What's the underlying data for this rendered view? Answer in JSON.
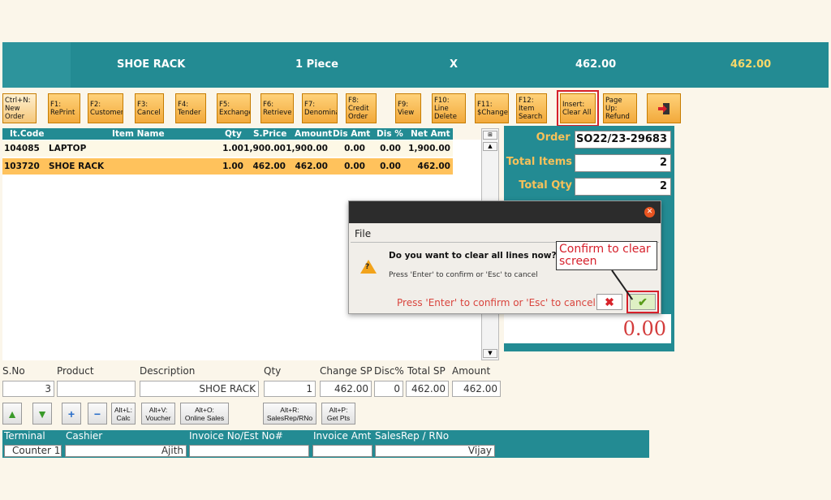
{
  "topbar": {
    "item": "SHOE RACK",
    "qty": "1 Piece",
    "x": "X",
    "price": "462.00",
    "total": "462.00"
  },
  "toolbar": [
    {
      "label": "Ctrl+N:\nNew\nOrder"
    },
    {
      "label": "F1:\nRePrint"
    },
    {
      "label": "F2:\nCustomer"
    },
    {
      "label": "F3:\nCancel"
    },
    {
      "label": "F4:\nTender"
    },
    {
      "label": "F5:\nExchange"
    },
    {
      "label": "F6:\nRetrieve"
    },
    {
      "label": "F7:\nDenomina"
    },
    {
      "label": "F8:\nCredit\nOrder"
    },
    {
      "label": "F9:\nView"
    },
    {
      "label": "F10:\nLine\nDelete"
    },
    {
      "label": "F11:\n$Change"
    },
    {
      "label": "F12:\nItem\nSearch"
    },
    {
      "label": "Insert:\nClear All"
    },
    {
      "label": "Page Up:\nRefund"
    }
  ],
  "grid": {
    "headers": [
      "It.Code",
      "Item Name",
      "Qty",
      "S.Price",
      "Amount",
      "Dis Amt",
      "Dis %",
      "Net Amt"
    ],
    "rows": [
      [
        "104085",
        "LAPTOP",
        "1.00",
        "1,900.00",
        "1,900.00",
        "0.00",
        "0.00",
        "1,900.00"
      ],
      [
        "103720",
        "SHOE RACK",
        "1.00",
        "462.00",
        "462.00",
        "0.00",
        "0.00",
        "462.00"
      ]
    ]
  },
  "right_panel": {
    "order_no_label": "Order No",
    "order_no": "SO22/23-29683",
    "total_items_label": "Total Items",
    "total_items": "2",
    "total_qty_label": "Total Qty",
    "total_qty": "2",
    "amount": "0.00"
  },
  "dialog": {
    "menu": "File",
    "question": "Do you want to clear all lines now?",
    "hint": "Press 'Enter' to confirm or 'Esc' to cancel",
    "hint_red": "Press 'Enter' to confirm or 'Esc' to cancel",
    "close_glyph": "✕",
    "cancel_glyph": "✖",
    "ok_glyph": "✔"
  },
  "callout": "Confirm to clear screen",
  "entry": {
    "labels": [
      "S.No",
      "Product",
      "Description",
      "Qty",
      "Change SP",
      "Disc%",
      "Total SP",
      "Amount"
    ],
    "sno": "3",
    "product": "",
    "description": "SHOE RACK",
    "qty": "1",
    "change_sp": "462.00",
    "disc": "0",
    "total_sp": "462.00",
    "amount": "462.00"
  },
  "small_buttons": [
    "Alt+L:\nCalc",
    "Alt+V:\nVoucher",
    "Alt+O:\nOnline Sales",
    "Alt+R:\nSalesRep/RNo",
    "Alt+P:\nGet Pts"
  ],
  "footer": {
    "labels": [
      "Terminal",
      "Cashier",
      "Invoice No/Est No#",
      "Invoice Amt",
      "SalesRep / RNo"
    ],
    "terminal": "Counter 1",
    "cashier": "Ajith",
    "invoice_no": "",
    "invoice_amt": "",
    "salesrep": "Vijay"
  }
}
